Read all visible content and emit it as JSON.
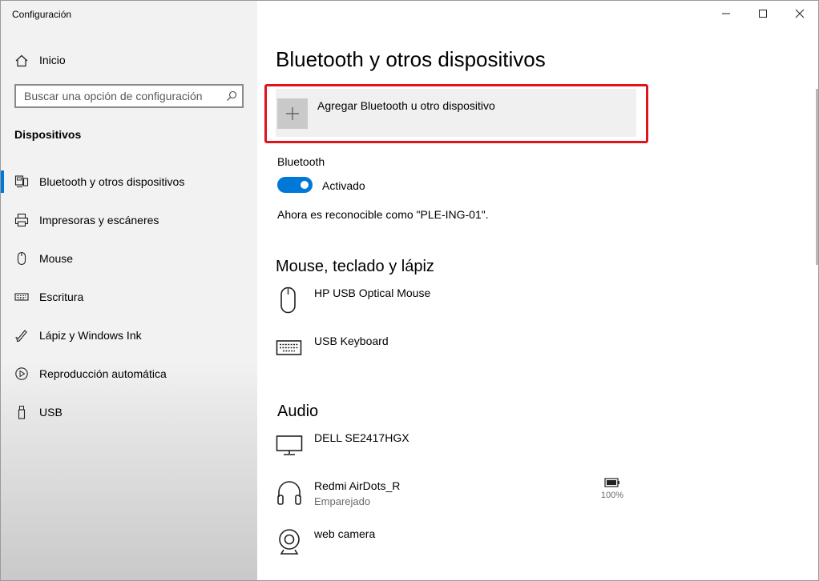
{
  "window": {
    "title": "Configuración"
  },
  "sidebar": {
    "home_label": "Inicio",
    "search_placeholder": "Buscar una opción de configuración",
    "section_title": "Dispositivos",
    "items": [
      {
        "label": "Bluetooth y otros dispositivos",
        "icon": "bluetooth-devices-icon",
        "active": true
      },
      {
        "label": "Impresoras y escáneres",
        "icon": "printer-icon"
      },
      {
        "label": "Mouse",
        "icon": "mouse-icon"
      },
      {
        "label": "Escritura",
        "icon": "keyboard-icon"
      },
      {
        "label": "Lápiz y Windows Ink",
        "icon": "pen-icon"
      },
      {
        "label": "Reproducción automática",
        "icon": "autoplay-icon"
      },
      {
        "label": "USB",
        "icon": "usb-icon"
      }
    ]
  },
  "main": {
    "title": "Bluetooth y otros dispositivos",
    "add_device_label": "Agregar Bluetooth u otro dispositivo",
    "bluetooth_label": "Bluetooth",
    "bluetooth_state": "Activado",
    "discoverable_text": "Ahora es reconocible como \"PLE-ING-01\".",
    "groups": {
      "input": {
        "title": "Mouse, teclado y lápiz",
        "devices": [
          {
            "name": "HP USB Optical Mouse",
            "icon": "mouse-icon"
          },
          {
            "name": "USB Keyboard",
            "icon": "keyboard-icon"
          }
        ]
      },
      "audio": {
        "title": "Audio",
        "devices": [
          {
            "name": "DELL SE2417HGX",
            "icon": "monitor-icon"
          },
          {
            "name": "Redmi AirDots_R",
            "status": "Emparejado",
            "battery": "100%",
            "icon": "headphones-icon"
          },
          {
            "name": "web camera",
            "icon": "webcam-icon"
          }
        ]
      }
    }
  },
  "colors": {
    "accent": "#0078d7",
    "highlight_border": "#e0121a",
    "sidebar_bg": "#f2f2f2"
  }
}
